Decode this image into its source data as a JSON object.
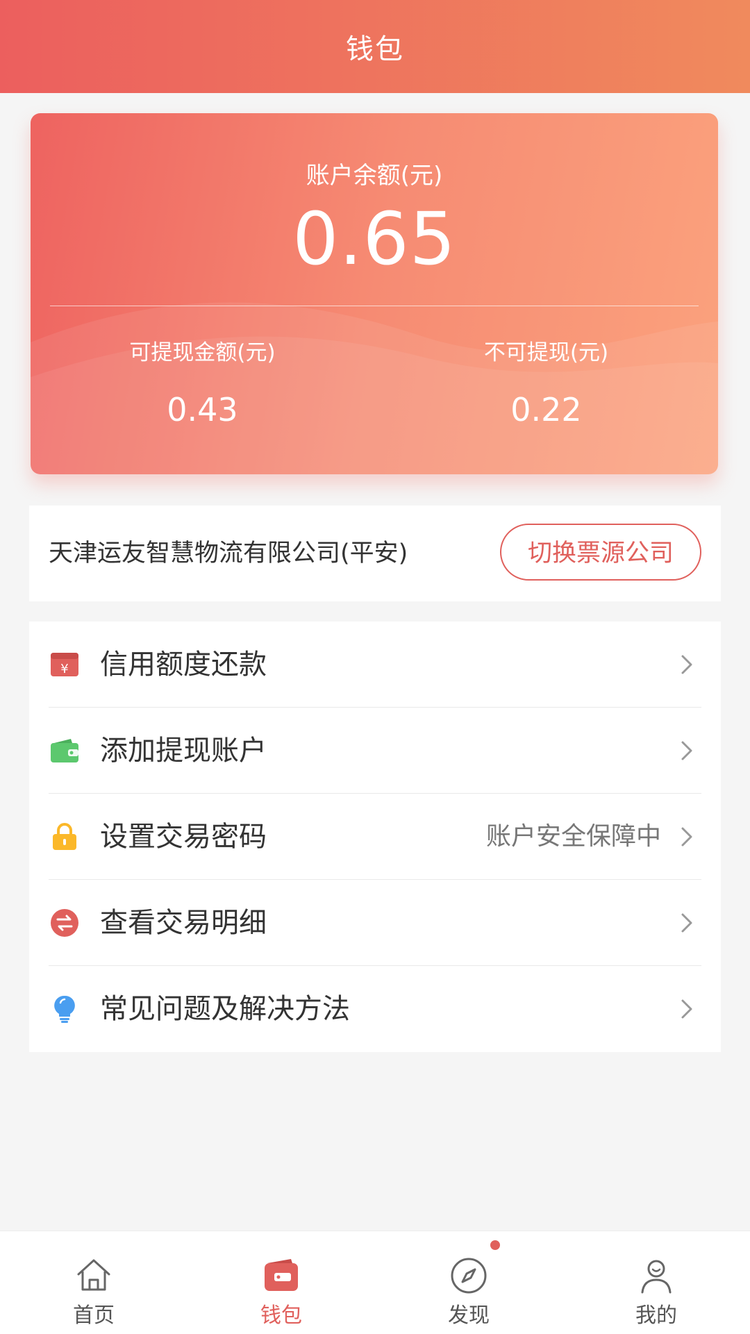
{
  "header": {
    "title": "钱包"
  },
  "balance_card": {
    "balance_label": "账户余额(元)",
    "balance_value": "0.65",
    "withdrawable_label": "可提现金额(元)",
    "withdrawable_value": "0.43",
    "non_withdrawable_label": "不可提现(元)",
    "non_withdrawable_value": "0.22"
  },
  "company": {
    "name": "天津运友智慧物流有限公司(平安)",
    "switch_label": "切换票源公司"
  },
  "menu": {
    "items": [
      {
        "label": "信用额度还款",
        "hint": "",
        "icon": "credit-repay-icon",
        "color": "#e0605c"
      },
      {
        "label": "添加提现账户",
        "hint": "",
        "icon": "wallet-icon",
        "color": "#5cc86e"
      },
      {
        "label": "设置交易密码",
        "hint": "账户安全保障中",
        "icon": "lock-icon",
        "color": "#fbb829"
      },
      {
        "label": "查看交易明细",
        "hint": "",
        "icon": "exchange-icon",
        "color": "#e0605c"
      },
      {
        "label": "常见问题及解决方法",
        "hint": "",
        "icon": "lightbulb-icon",
        "color": "#4a9ef0"
      }
    ]
  },
  "tabbar": {
    "items": [
      {
        "label": "首页",
        "icon": "home-icon",
        "active": false
      },
      {
        "label": "钱包",
        "icon": "wallet-icon",
        "active": true
      },
      {
        "label": "发现",
        "icon": "compass-icon",
        "active": false
      },
      {
        "label": "我的",
        "icon": "user-icon",
        "active": false
      }
    ],
    "accent_color": "#e0605c"
  }
}
